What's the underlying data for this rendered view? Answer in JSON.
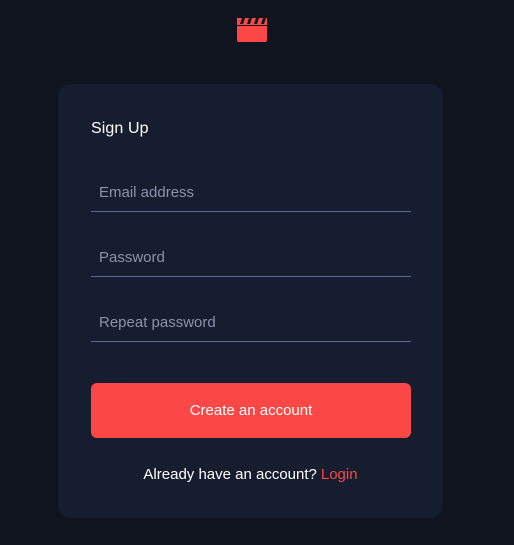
{
  "brand": {
    "logo_icon": "movie-clapperboard-icon",
    "accent_color": "#fc4747"
  },
  "form": {
    "title": "Sign Up",
    "fields": [
      {
        "placeholder": "Email address",
        "value": ""
      },
      {
        "placeholder": "Password",
        "value": ""
      },
      {
        "placeholder": "Repeat password",
        "value": ""
      }
    ],
    "submit_label": "Create an account",
    "footer_text": "Already have an account?",
    "login_link": "Login"
  },
  "colors": {
    "page_background": "#10141e",
    "card_background": "#161d2f",
    "field_border": "#5a698f",
    "placeholder_text": "#8a93a8",
    "text": "#ffffff"
  }
}
